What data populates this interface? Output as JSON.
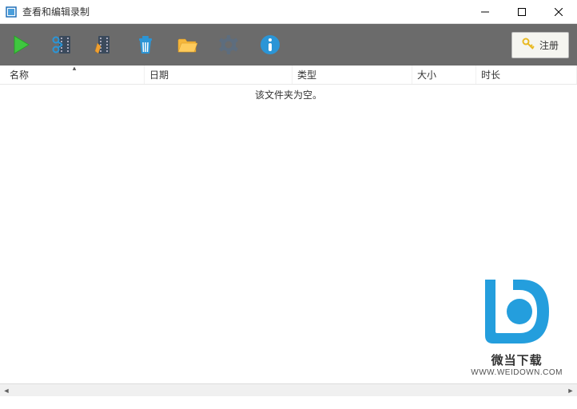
{
  "window": {
    "title": "查看和编辑录制",
    "controls": {
      "minimize": "—",
      "maximize": "☐",
      "close": "✕"
    }
  },
  "toolbar": {
    "play": "play-icon",
    "split": "split-film-icon",
    "film": "film-icon",
    "trash": "trash-icon",
    "folder": "folder-icon",
    "gear": "gear-icon",
    "info": "info-icon",
    "register_label": "注册"
  },
  "columns": {
    "name": "名称",
    "date": "日期",
    "type": "类型",
    "size": "大小",
    "duration": "时长"
  },
  "empty_message": "该文件夹为空。",
  "watermark": {
    "brand": "微当下载",
    "url": "WWW.WEIDOWN.COM"
  }
}
